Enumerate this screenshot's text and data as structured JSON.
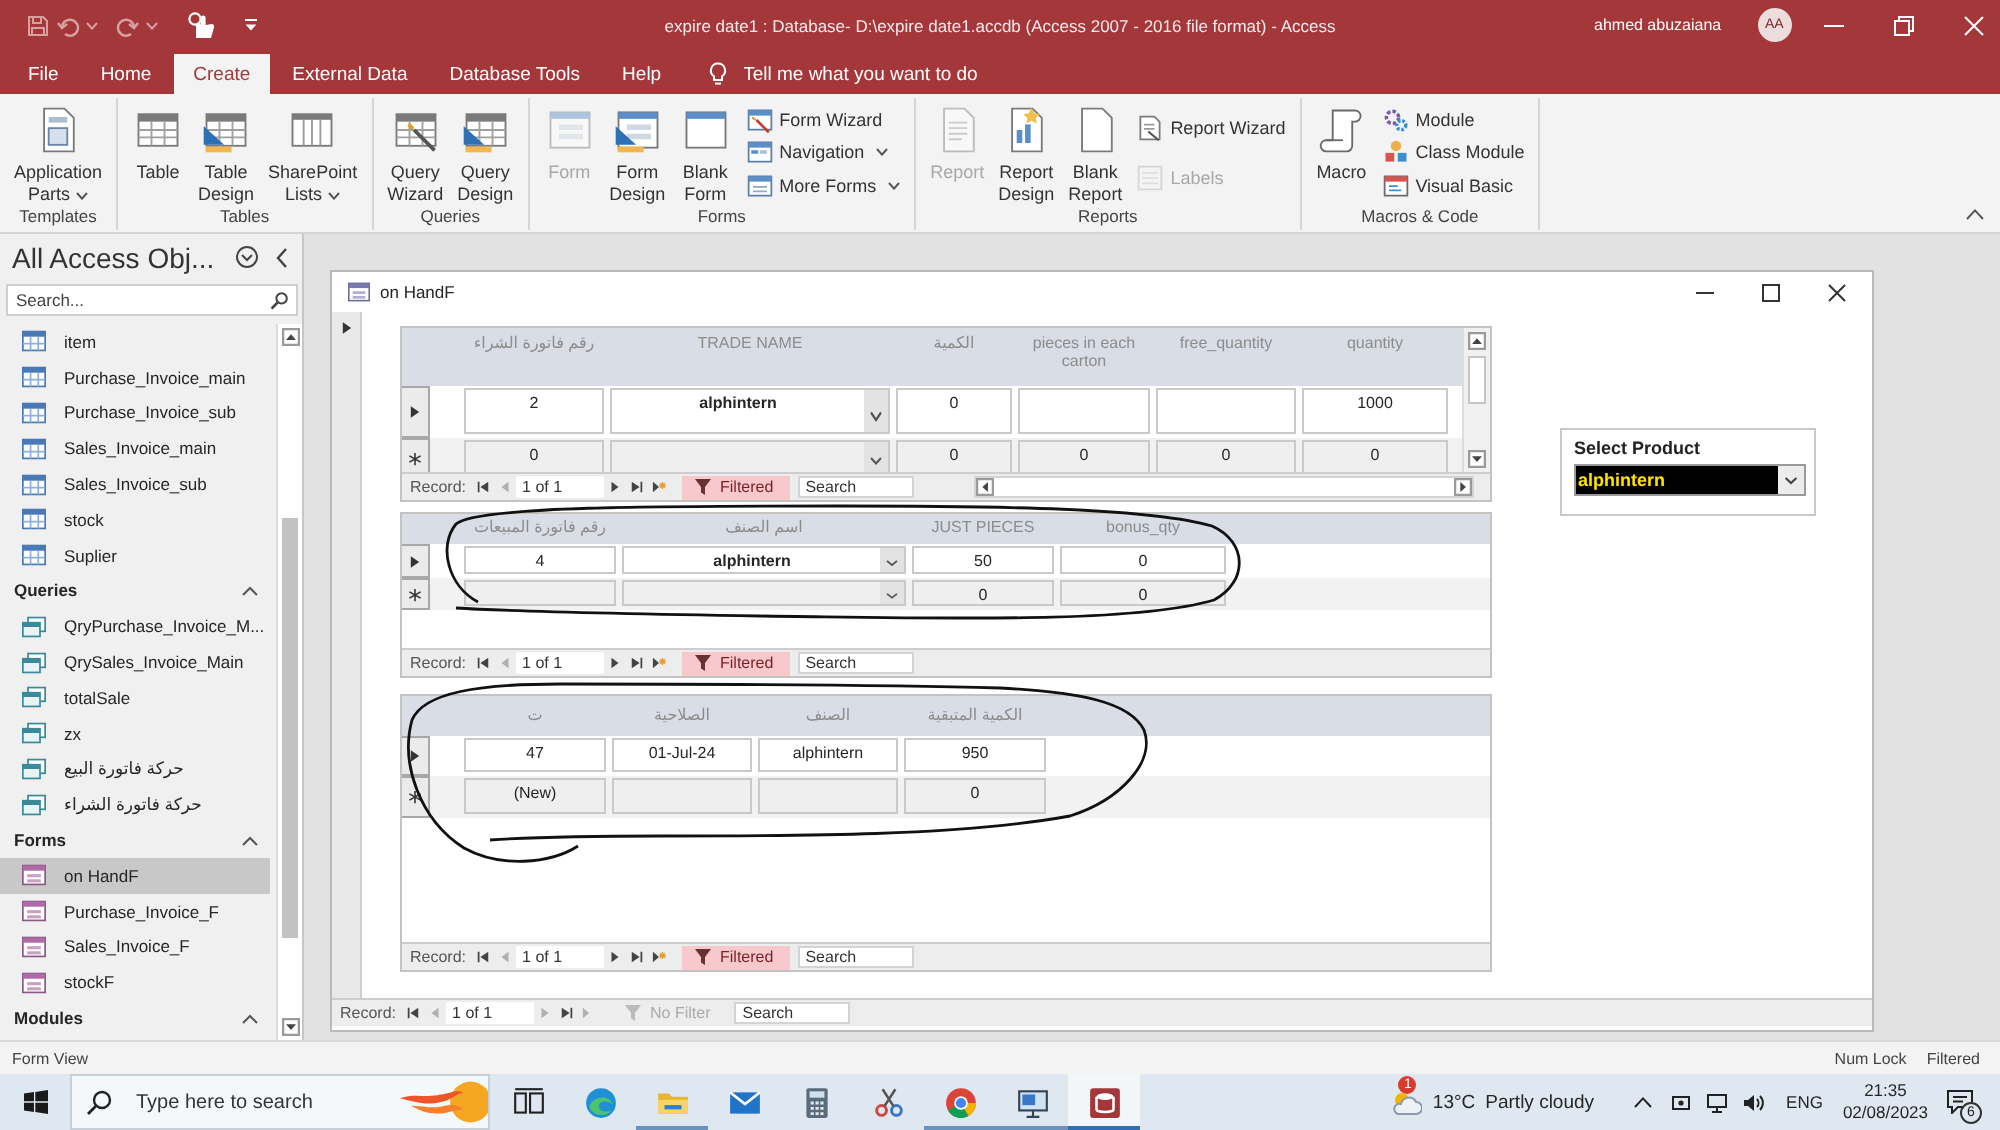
{
  "window": {
    "title": "expire date1 : Database- D:\\expire date1.accdb (Access 2007 - 2016 file format) - Access",
    "user": "ahmed abuzaiana",
    "avatar": "AA"
  },
  "menu_tabs": [
    {
      "label": "File",
      "selected": false
    },
    {
      "label": "Home",
      "selected": false
    },
    {
      "label": "Create",
      "selected": true
    },
    {
      "label": "External Data",
      "selected": false
    },
    {
      "label": "Database Tools",
      "selected": false
    },
    {
      "label": "Help",
      "selected": false
    }
  ],
  "tell_me": {
    "placeholder": "Tell me what you want to do"
  },
  "ribbon": [
    {
      "label": "Templates",
      "items": [
        {
          "kind": "large",
          "label": "Application Parts",
          "dropdown": true,
          "disabled": false
        }
      ]
    },
    {
      "label": "Tables",
      "items": [
        {
          "kind": "large",
          "label": "Table",
          "dropdown": false,
          "disabled": false
        },
        {
          "kind": "large",
          "label": "Table Design",
          "dropdown": false,
          "disabled": false
        },
        {
          "kind": "large",
          "label": "SharePoint Lists",
          "dropdown": true,
          "disabled": false
        }
      ]
    },
    {
      "label": "Queries",
      "items": [
        {
          "kind": "large",
          "label": "Query Wizard",
          "dropdown": false,
          "disabled": false
        },
        {
          "kind": "large",
          "label": "Query Design",
          "dropdown": false,
          "disabled": false
        }
      ]
    },
    {
      "label": "Forms",
      "items": [
        {
          "kind": "large",
          "label": "Form",
          "dropdown": false,
          "disabled": true
        },
        {
          "kind": "large",
          "label": "Form Design",
          "dropdown": false,
          "disabled": false
        },
        {
          "kind": "large",
          "label": "Blank Form",
          "dropdown": false,
          "disabled": false
        },
        {
          "kind": "small",
          "label": "Form Wizard",
          "dropdown": false,
          "disabled": false
        },
        {
          "kind": "small",
          "label": "Navigation",
          "dropdown": true,
          "disabled": false
        },
        {
          "kind": "small",
          "label": "More Forms",
          "dropdown": true,
          "disabled": false
        }
      ]
    },
    {
      "label": "Reports",
      "items": [
        {
          "kind": "large",
          "label": "Report",
          "dropdown": false,
          "disabled": true
        },
        {
          "kind": "large",
          "label": "Report Design",
          "dropdown": false,
          "disabled": false
        },
        {
          "kind": "large",
          "label": "Blank Report",
          "dropdown": false,
          "disabled": false
        },
        {
          "kind": "small",
          "label": "Report Wizard",
          "dropdown": false,
          "disabled": false
        },
        {
          "kind": "small",
          "label": "Labels",
          "dropdown": false,
          "disabled": true
        }
      ]
    },
    {
      "label": "Macros & Code",
      "items": [
        {
          "kind": "large",
          "label": "Macro",
          "dropdown": false,
          "disabled": false
        },
        {
          "kind": "small",
          "label": "Module",
          "dropdown": false,
          "disabled": false
        },
        {
          "kind": "small",
          "label": "Class Module",
          "dropdown": false,
          "disabled": false
        },
        {
          "kind": "small",
          "label": "Visual Basic",
          "dropdown": false,
          "disabled": false
        }
      ]
    }
  ],
  "nav_pane": {
    "title": "All Access Obj...",
    "search": {
      "placeholder": "Search..."
    },
    "groups": [
      {
        "kind": "table",
        "items": [
          {
            "label": "item",
            "selected": false
          },
          {
            "label": "Purchase_Invoice_main",
            "selected": false
          },
          {
            "label": "Purchase_Invoice_sub",
            "selected": false
          },
          {
            "label": "Sales_Invoice_main",
            "selected": false
          },
          {
            "label": "Sales_Invoice_sub",
            "selected": false
          },
          {
            "label": "stock",
            "selected": false
          },
          {
            "label": "Suplier",
            "selected": false
          }
        ]
      },
      {
        "kind": "query",
        "label": "Queries",
        "expanded": true,
        "items": [
          {
            "label": "QryPurchase_Invoice_M...",
            "selected": false
          },
          {
            "label": "QrySales_Invoice_Main",
            "selected": false
          },
          {
            "label": "totalSale",
            "selected": false
          },
          {
            "label": "zx",
            "selected": false
          },
          {
            "label": "حركة فاتورة البيع",
            "selected": false
          },
          {
            "label": "حركة فاتورة الشراء",
            "selected": false
          }
        ]
      },
      {
        "kind": "form",
        "label": "Forms",
        "expanded": true,
        "items": [
          {
            "label": "on HandF",
            "selected": true
          },
          {
            "label": "Purchase_Invoice_F",
            "selected": false
          },
          {
            "label": "Sales_Invoice_F",
            "selected": false
          },
          {
            "label": "stockF",
            "selected": false
          }
        ]
      },
      {
        "label": "Modules",
        "expanded": true
      }
    ]
  },
  "form": {
    "title": "on HandF",
    "subforms": [
      {
        "columns": [
          {
            "label": "رقم فاتورة الشراء",
            "kind": "text"
          },
          {
            "label": "TRADE NAME",
            "kind": "combo"
          },
          {
            "label": "الكمية",
            "kind": "text"
          },
          {
            "label": "pieces in each carton",
            "kind": "text"
          },
          {
            "label": "free_quantity",
            "kind": "text"
          },
          {
            "label": "quantity",
            "kind": "text"
          }
        ],
        "rows": [
          {
            "kind": "current",
            "cells": [
              "2",
              "alphintern",
              "0",
              null,
              null,
              "1000"
            ]
          },
          {
            "kind": "new",
            "cells": [
              "0",
              null,
              "0",
              "0",
              "0",
              "0"
            ]
          }
        ],
        "navigator": {
          "label": "Record:",
          "position": "1 of 1",
          "filter": {
            "label": "Filtered",
            "active": true
          },
          "search": {
            "placeholder": "Search"
          }
        }
      },
      {
        "columns": [
          {
            "label": "رقم فاتورة المبيعات",
            "kind": "text"
          },
          {
            "label": "اسم الصنف",
            "kind": "combo"
          },
          {
            "label": "JUST PIECES",
            "kind": "text"
          },
          {
            "label": "bonus_qty",
            "kind": "text"
          }
        ],
        "rows": [
          {
            "kind": "current",
            "cells": [
              "4",
              "alphintern",
              "50",
              "0"
            ]
          },
          {
            "kind": "new",
            "cells": [
              null,
              null,
              "0",
              "0"
            ]
          }
        ],
        "navigator": {
          "label": "Record:",
          "position": "1 of 1",
          "filter": {
            "label": "Filtered",
            "active": true
          },
          "search": {
            "placeholder": "Search"
          }
        }
      },
      {
        "columns": [
          {
            "label": "ت",
            "kind": "text"
          },
          {
            "label": "الصلاحية",
            "kind": "text"
          },
          {
            "label": "الصنف",
            "kind": "text"
          },
          {
            "label": "الكمية المتبقية",
            "kind": "text"
          }
        ],
        "rows": [
          {
            "kind": "current",
            "cells": [
              "47",
              "01-Jul-24",
              "alphintern",
              "950"
            ]
          },
          {
            "kind": "new",
            "cells": [
              "(New)",
              null,
              null,
              "0"
            ]
          }
        ],
        "navigator": {
          "label": "Record:",
          "position": "1 of 1",
          "filter": {
            "label": "Filtered",
            "active": true
          },
          "search": {
            "placeholder": "Search"
          }
        }
      }
    ],
    "select_product": {
      "label": "Select Product",
      "value": "alphintern",
      "highlighted": true
    },
    "navigator": {
      "label": "Record:",
      "position": "1 of 1",
      "filter": {
        "label": "No Filter",
        "active": false
      },
      "search": {
        "placeholder": "Search"
      }
    }
  },
  "status_bar": {
    "view": "Form View",
    "indicators": [
      "Num Lock",
      "Filtered"
    ]
  },
  "taskbar": {
    "search": {
      "placeholder": "Type here to search"
    },
    "apps": [
      {
        "running": false,
        "selected": false
      },
      {
        "running": false,
        "selected": false
      },
      {
        "running": true,
        "selected": false
      },
      {
        "running": false,
        "selected": false
      },
      {
        "running": false,
        "selected": false
      },
      {
        "running": false,
        "selected": false
      },
      {
        "running": true,
        "selected": false
      },
      {
        "running": true,
        "selected": false
      },
      {
        "running": true,
        "selected": true
      }
    ],
    "weather": {
      "temperature": "13°C",
      "condition": "Partly cloudy",
      "badge": "1"
    },
    "language": "ENG",
    "time": "21:35",
    "date": "02/08/2023",
    "notifications": "6"
  }
}
